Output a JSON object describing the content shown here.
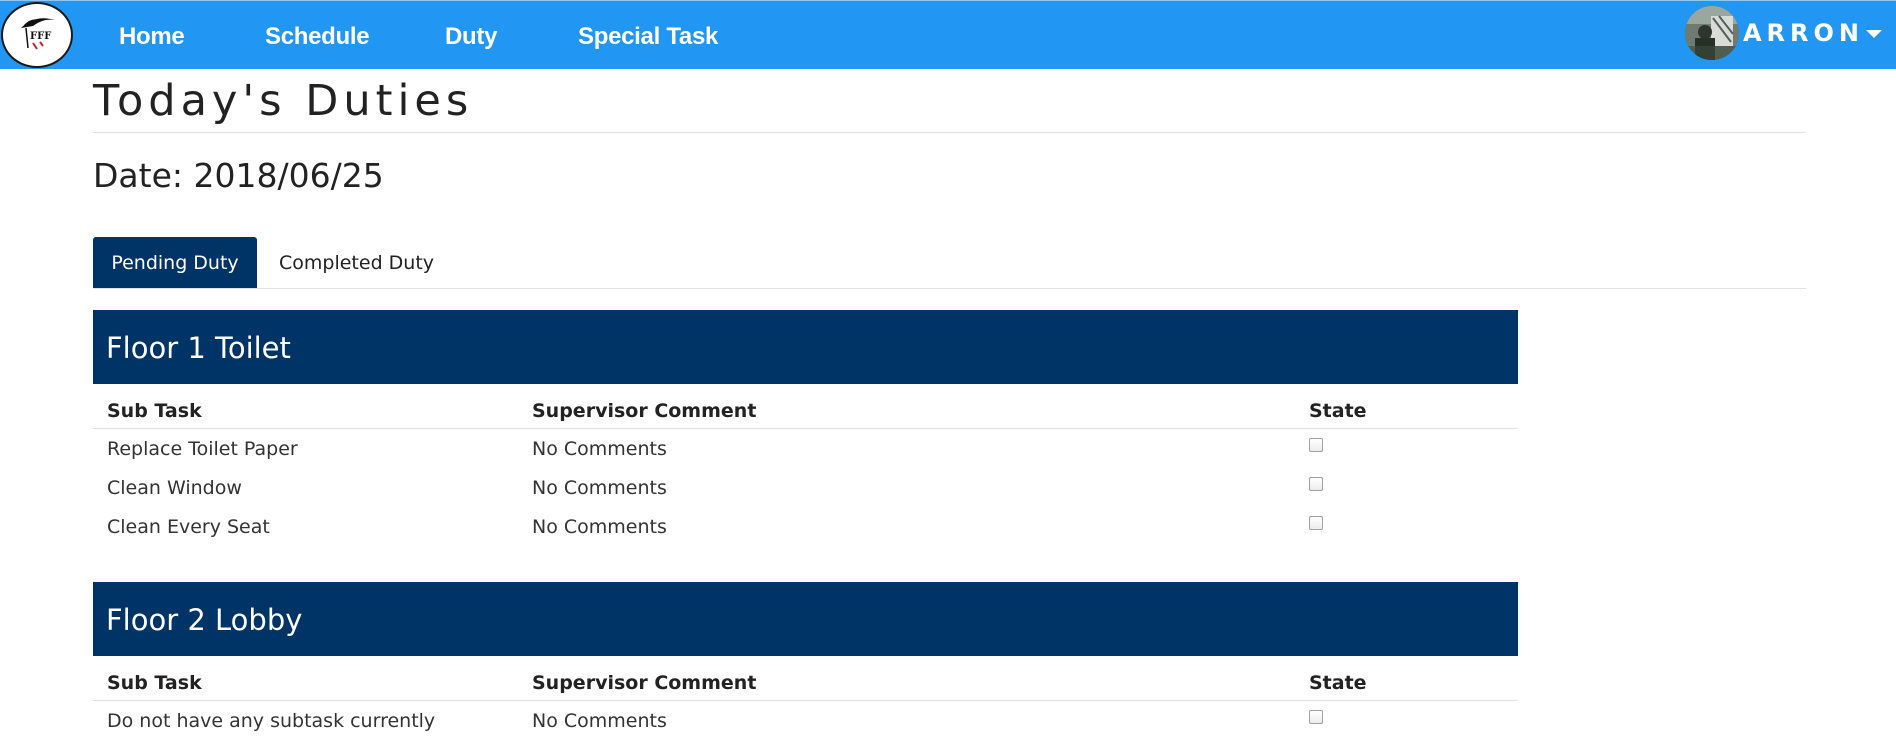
{
  "nav": {
    "logo_alt": "FFF",
    "items": [
      {
        "label": "Home"
      },
      {
        "label": "Schedule"
      },
      {
        "label": "Duty"
      },
      {
        "label": "Special Task"
      }
    ],
    "user": {
      "name": "ARRON"
    }
  },
  "page": {
    "title": "Today's Duties",
    "date_line": "Date: 2018/06/25"
  },
  "tabs": [
    {
      "label": "Pending Duty",
      "active": true
    },
    {
      "label": "Completed Duty",
      "active": false
    }
  ],
  "sections": [
    {
      "title": "Floor 1 Toilet",
      "columns": [
        "Sub Task",
        "Supervisor Comment",
        "State"
      ],
      "rows": [
        {
          "sub_task": "Replace Toilet Paper",
          "comment": "No Comments",
          "done": false
        },
        {
          "sub_task": "Clean Window",
          "comment": "No Comments",
          "done": false
        },
        {
          "sub_task": "Clean Every Seat",
          "comment": "No Comments",
          "done": false
        }
      ]
    },
    {
      "title": "Floor 2 Lobby",
      "columns": [
        "Sub Task",
        "Supervisor Comment",
        "State"
      ],
      "rows": [
        {
          "sub_task": "Do not have any subtask currently",
          "comment": "No Comments",
          "done": false
        }
      ]
    }
  ],
  "colors": {
    "navbar": "#2196f3",
    "section_header": "#003366",
    "active_tab": "#003366"
  }
}
